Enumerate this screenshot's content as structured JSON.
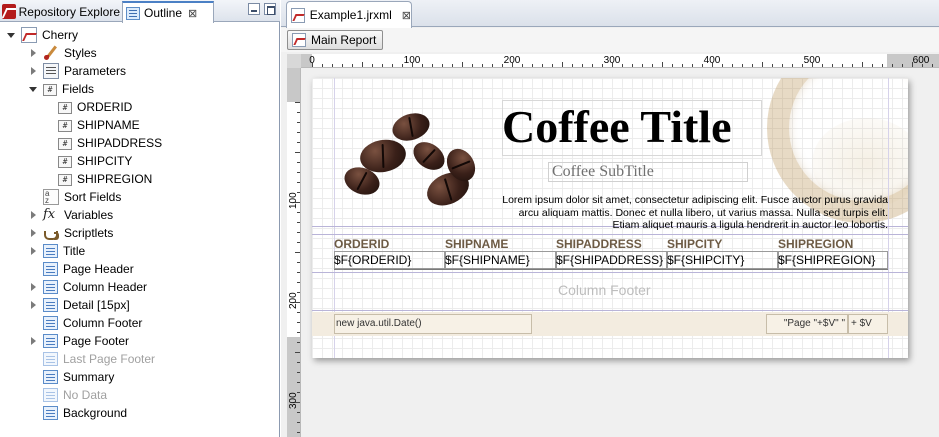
{
  "left_tabs": [
    {
      "label": "Repository Explore",
      "icon": "repository-icon"
    },
    {
      "label": "Outline",
      "icon": "outline-icon",
      "close": "⊠"
    }
  ],
  "tree": {
    "root": "Cherry",
    "items": [
      {
        "label": "Styles",
        "icon": "styles-icon"
      },
      {
        "label": "Parameters",
        "icon": "parameters-icon"
      },
      {
        "label": "Fields",
        "icon": "fields-icon",
        "children": [
          "ORDERID",
          "SHIPNAME",
          "SHIPADDRESS",
          "SHIPCITY",
          "SHIPREGION"
        ]
      },
      {
        "label": "Sort Fields",
        "icon": "sort-fields-icon"
      },
      {
        "label": "Variables",
        "icon": "variables-icon"
      },
      {
        "label": "Scriptlets",
        "icon": "scriptlets-icon"
      },
      {
        "label": "Title",
        "icon": "band-icon"
      },
      {
        "label": "Page Header",
        "icon": "band-icon"
      },
      {
        "label": "Column Header",
        "icon": "band-icon"
      },
      {
        "label": "Detail [15px]",
        "icon": "band-icon"
      },
      {
        "label": "Column Footer",
        "icon": "band-icon"
      },
      {
        "label": "Page Footer",
        "icon": "band-icon"
      },
      {
        "label": "Last Page Footer",
        "icon": "band-icon",
        "disabled": true
      },
      {
        "label": "Summary",
        "icon": "band-icon"
      },
      {
        "label": "No Data",
        "icon": "band-icon",
        "disabled": true
      },
      {
        "label": "Background",
        "icon": "band-icon"
      }
    ]
  },
  "editor": {
    "file_tab": "Example1.jrxml",
    "file_tab_close": "⊠",
    "main_report_button": "Main Report"
  },
  "rulers": {
    "horizontal_labels": [
      "0",
      "100",
      "200",
      "300",
      "400",
      "500",
      "600"
    ],
    "vertical_labels": [
      "100",
      "200",
      "300"
    ]
  },
  "report": {
    "title": "Coffee Title",
    "subtitle": "Coffee SubTitle",
    "subtitle_ghost": "Title",
    "lorem": "Lorem ipsum dolor sit amet, consectetur adipiscing elit. Fusce auctor purus gravida arcu aliquam mattis. Donec et nulla libero, ut varius massa. Nulla sed turpis elit. Etiam aliquet mauris a ligula hendrerit in auctor leo lobortis.",
    "column_headers": [
      "ORDERID",
      "SHIPNAME",
      "SHIPADDRESS",
      "SHIPCITY",
      "SHIPREGION"
    ],
    "detail_fields": [
      "$F{ORDERID}",
      "$F{SHIPNAME}",
      "$F{SHIPADDRESS}",
      "$F{SHIPCITY}",
      "$F{SHIPREGION}"
    ],
    "column_footer_label": "Column Footer",
    "footer_date": "new java.util.Date()",
    "footer_page": "\"Page \"+$V\" \"",
    "footer_total": "+ $V",
    "colors": {
      "header_text": "#6d5b45",
      "footer_band": "#f3ece0",
      "band_lines": "#b9b4d8"
    }
  }
}
